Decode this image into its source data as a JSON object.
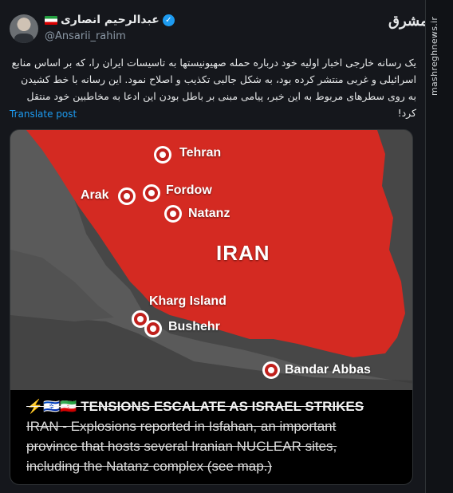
{
  "author": {
    "display_name": "عبدالرحیم انصاری",
    "handle": "@Ansarii_rahim"
  },
  "post": {
    "text": "یک رسانه خارجی اخبار اولیه خود درباره حمله صهیونیستها به تاسیسات ایران را، که بر اساس منابع اسرائیلی و غربی منتشر کرده بود، به شکل جالبی تکذیب و اصلاح نمود. این رسانه با خط کشیدن به روی سطرهای مربوط به این خبر، پیامی مبنی بر باطل بودن این ادعا به مخاطبین خود منتقل کرد!",
    "translate_label": "Translate post"
  },
  "media": {
    "map_labels": {
      "tehran": "Tehran",
      "arak": "Arak",
      "fordow": "Fordow",
      "natanz": "Natanz",
      "iran": "IRAN",
      "kharg": "Kharg Island",
      "bushehr": "Bushehr",
      "bandar": "Bandar Abbas"
    },
    "caption_line1": "⚡🇮🇱🇮🇷 TENSIONS ESCALATE AS ISRAEL STRIKES",
    "caption_line2": "IRAN - Explosions reported in Isfahan, an important",
    "caption_line3": "province that hosts several Iranian NUCLEAR sites,",
    "caption_line4": "including the Natanz complex (see map.)"
  },
  "brand": {
    "logo_text": "مشرق",
    "watermark": "mashreghnews.ir"
  },
  "colors": {
    "background": "#15171c",
    "link": "#1d9bf0",
    "map_red": "#d42a22"
  },
  "icons": {
    "verified": "verified-badge-icon",
    "flag": "iran-flag-icon"
  }
}
